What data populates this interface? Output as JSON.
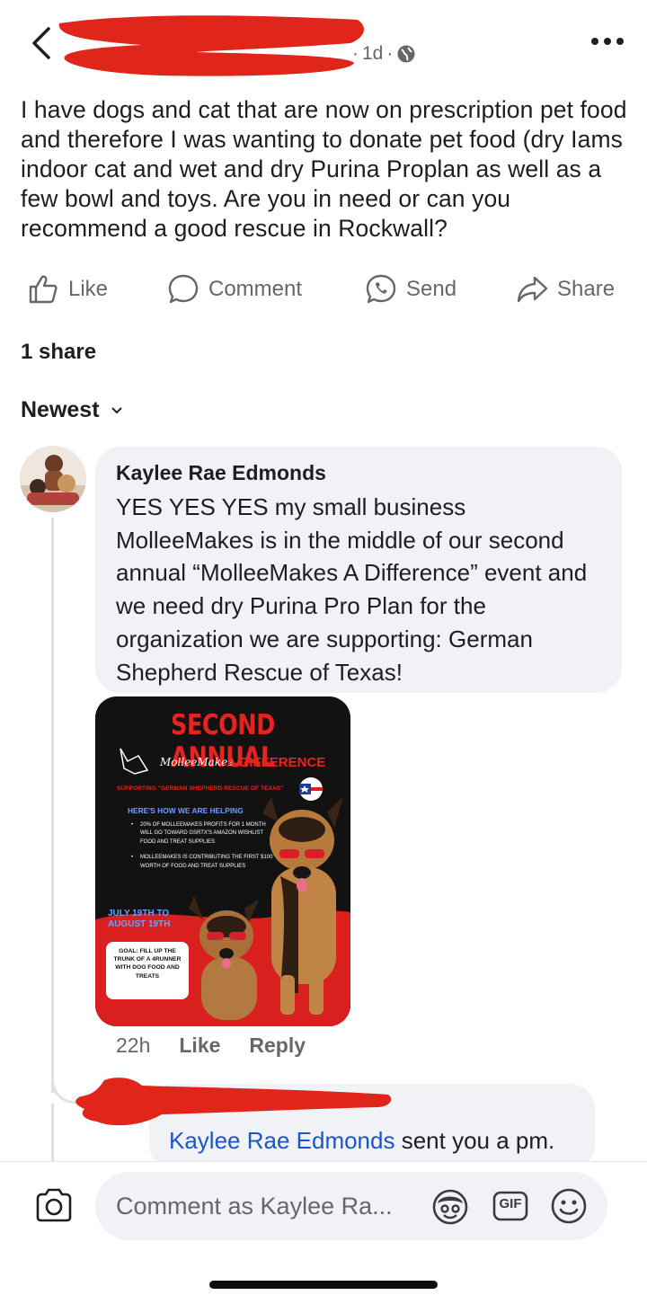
{
  "header": {
    "time": "1d",
    "privacy_icon": "globe-icon",
    "more_icon": "more-horizontal-icon"
  },
  "post": {
    "text": "I have dogs and cat that are now on prescription pet food and therefore I was wanting to donate pet food (dry Iams indoor cat and wet and dry Purina Proplan as well as a few bowl and toys. Are you in need or can you recommend a good rescue in Rockwall?"
  },
  "actions": {
    "like": "Like",
    "comment": "Comment",
    "send": "Send",
    "share": "Share"
  },
  "share_count": "1 share",
  "sort_label": "Newest",
  "comment": {
    "author": "Kaylee Rae Edmonds",
    "text": "YES YES YES my small business MolleeMakes is in the middle of our second annual “MolleeMakes A Difference” event and we need dry Purina Pro Plan for the organization we are supporting: German Shepherd Rescue of Texas!",
    "time": "22h",
    "like": "Like",
    "reply": "Reply",
    "flyer": {
      "title": "SECOND ANNUAL",
      "brand": "MolleeMakes",
      "difference": "A DIFFERENCE",
      "supporting": "SUPPORTING \"GERMAN SHEPHERD RESCUE OF TEXAS\"",
      "how": "HERE'S HOW WE ARE HELPING",
      "bullet1": "20% OF MOLLEEMAKES PROFITS FOR 1 MONTH WILL GO TOWARD GSRTX'S AMAZON WISHLIST FOOD AND TREAT SUPPLIES",
      "bullet2": "MOLLEEMAKES IS CONTRIBUTING THE FIRST $100 WORTH OF FOOD AND TREAT SUPPLIES",
      "dates": "JULY 19TH TO AUGUST 19TH",
      "goal": "GOAL: FILL UP THE TRUNK OF A 4RUNNER WITH DOG FOOD AND TREATS"
    }
  },
  "reply": {
    "mention": "Kaylee Rae Edmonds",
    "text": " sent you a pm."
  },
  "composer": {
    "placeholder": "Comment as Kaylee Ra...",
    "gif_label": "GIF"
  },
  "colors": {
    "redaction": "#e0261b",
    "mention": "#1a56c9",
    "bubble": "#f0f2f5",
    "muted": "#65676b"
  }
}
